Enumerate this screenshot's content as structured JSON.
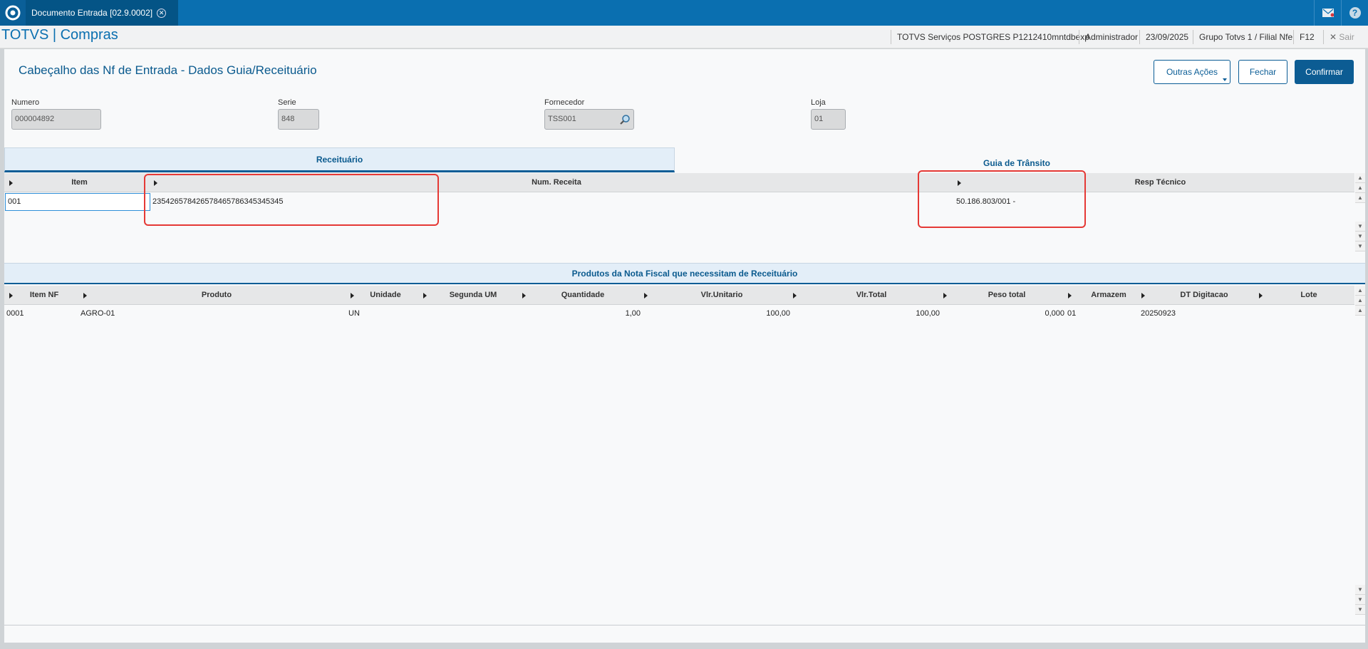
{
  "topbar": {
    "tab_label": "Documento Entrada [02.9.0002]",
    "close_glyph": "✕",
    "help_glyph": "?"
  },
  "header": {
    "app_title": "TOTVS | Compras",
    "environment": "TOTVS Serviços POSTGRES P1212410mntdbexp",
    "user": "Administrador",
    "date": "23/09/2025",
    "branch": "Grupo Totvs 1 / Filial Nfe",
    "shortcut": "F12",
    "exit_label": "Sair",
    "exit_glyph": "✕"
  },
  "page": {
    "title": "Cabeçalho das Nf de Entrada - Dados Guia/Receituário",
    "buttons": {
      "outras_acoes": "Outras Ações",
      "fechar": "Fechar",
      "confirmar": "Confirmar"
    }
  },
  "fields": {
    "numero": {
      "label": "Numero",
      "value": "000004892"
    },
    "serie": {
      "label": "Serie",
      "value": "848"
    },
    "fornecedor": {
      "label": "Fornecedor",
      "value": "TSS001"
    },
    "loja": {
      "label": "Loja",
      "value": "01"
    }
  },
  "tabs": [
    "Receituário",
    "Guia de Trânsito"
  ],
  "grid1": {
    "headers": [
      "Item",
      "Num. Receita",
      "Resp Técnico"
    ],
    "rows": [
      [
        "001",
        "235426578426578465786345345345",
        "50.186.803/001 -"
      ]
    ]
  },
  "section2_title": "Produtos da Nota Fiscal que necessitam de Receituário",
  "grid2": {
    "headers": [
      "Item NF",
      "Produto",
      "Unidade",
      "Segunda UM",
      "Quantidade",
      "Vlr.Unitario",
      "Vlr.Total",
      "Peso total",
      "Armazem",
      "DT Digitacao",
      "Lote"
    ],
    "rows": [
      [
        "0001",
        "AGRO-01",
        "UN",
        "",
        "1,00",
        "100,00",
        "100,00",
        "0,000",
        "01",
        "20250923",
        ""
      ]
    ]
  },
  "colors": {
    "brand_blue": "#0a6fb0",
    "dark_blue": "#0b5d96",
    "highlight_red": "#e53935"
  }
}
